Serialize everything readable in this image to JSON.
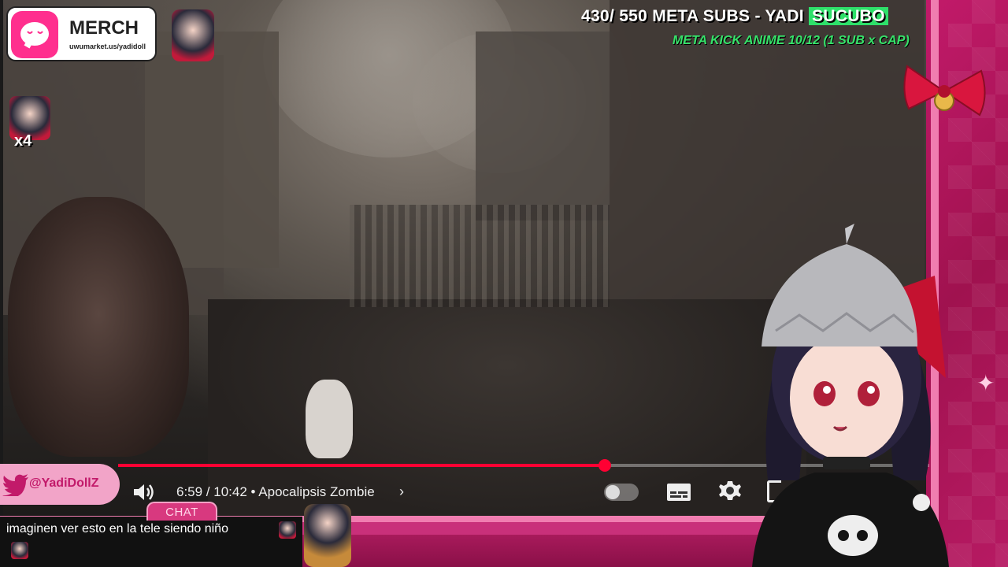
{
  "stream": {
    "subs_counter": "430/ 550 META SUBS - YADI",
    "subs_highlight": "SUCUBO",
    "goal_line": "META KICK ANIME  10/12  (1 SUB x CAP)"
  },
  "merch": {
    "title": "MERCH",
    "url": "uwumarket.us/yadidoll"
  },
  "multiplier": "x4",
  "player": {
    "time": "6:59 / 10:42",
    "separator": "•",
    "video_title": "Apocalipsis Zombie",
    "progress": 0.6,
    "chevron": "›"
  },
  "social": {
    "twitter_handle": "@YadiDollZ"
  },
  "chat": {
    "tab_label": "CHAT",
    "message": "imaginen ver esto en la tele siendo niño"
  },
  "colors": {
    "accent_pink": "#c21a6a",
    "progress_red": "#ff0033",
    "goal_green": "#36e36a"
  },
  "icons": {
    "volume": "volume-icon",
    "autoplay": "autoplay-toggle",
    "captions": "captions-icon",
    "settings": "gear-icon",
    "twitter": "twitter-bird-icon",
    "sparkle": "sparkle-icon"
  }
}
